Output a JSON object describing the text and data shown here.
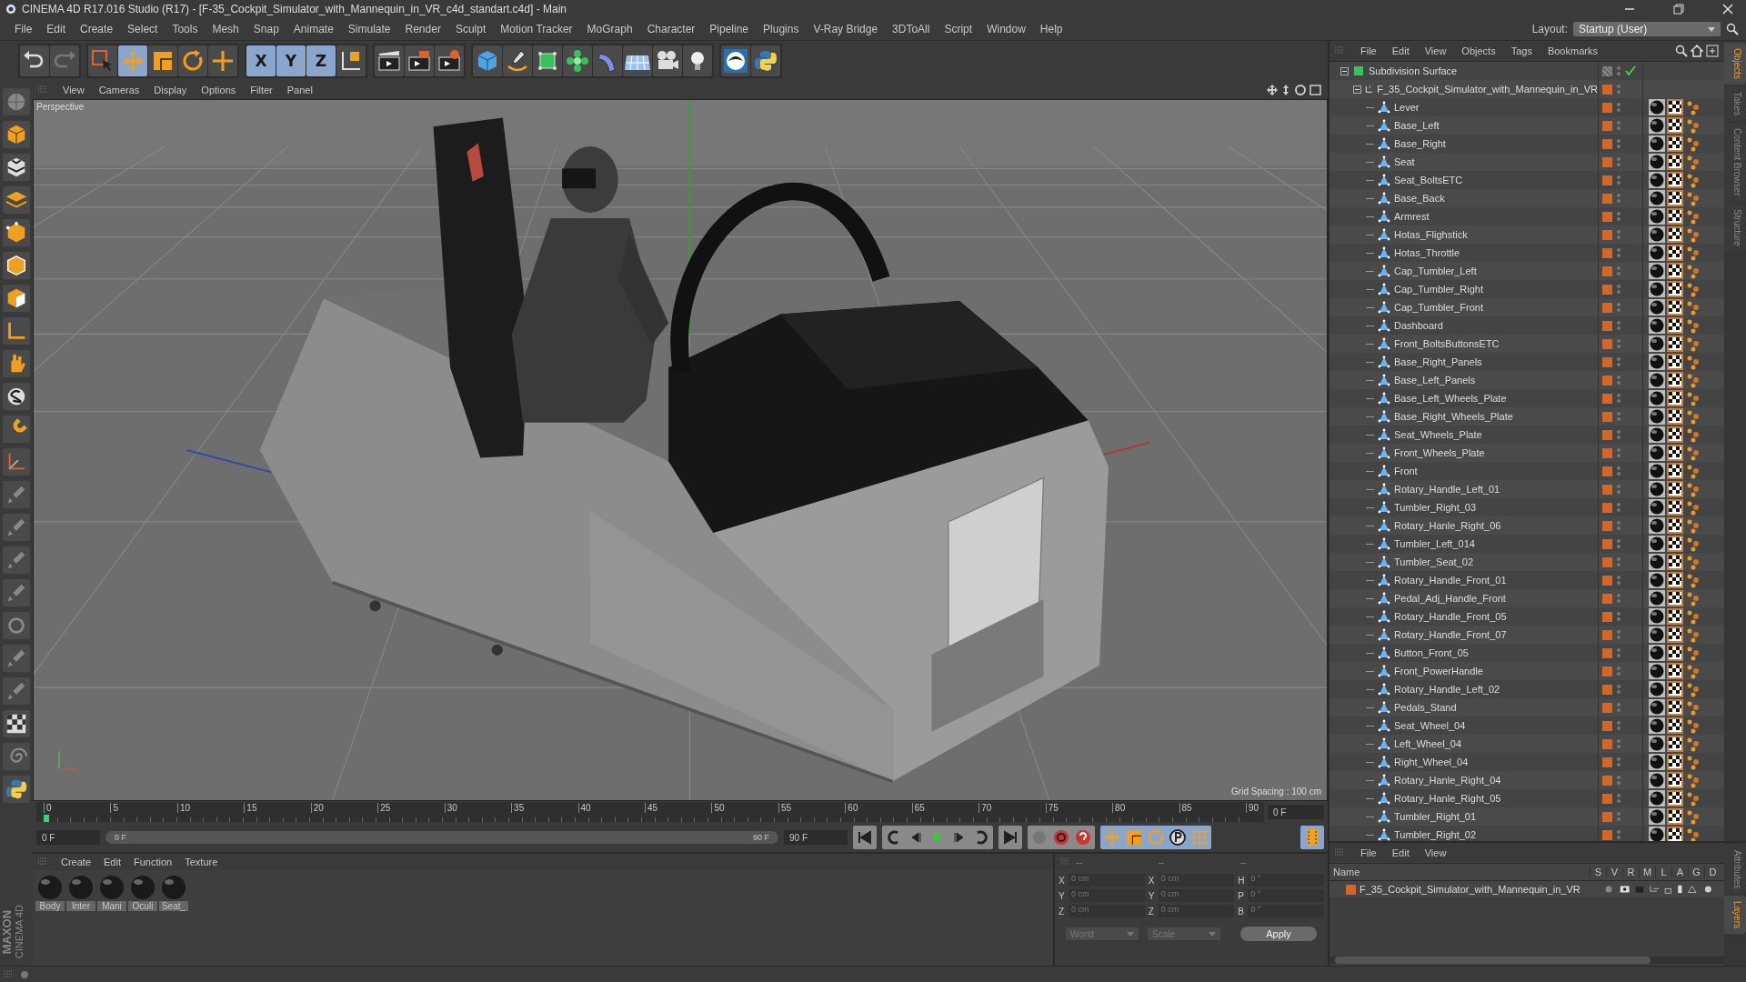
{
  "window": {
    "title": "CINEMA 4D R17.016 Studio (R17) - [F-35_Cockpit_Simulator_with_Mannequin_in_VR_c4d_standart.c4d] - Main"
  },
  "menu": [
    "File",
    "Edit",
    "Create",
    "Select",
    "Tools",
    "Mesh",
    "Snap",
    "Animate",
    "Simulate",
    "Render",
    "Sculpt",
    "Motion Tracker",
    "MoGraph",
    "Character",
    "Pipeline",
    "Plugins",
    "V-Ray Bridge",
    "3DToAll",
    "Script",
    "Window",
    "Help"
  ],
  "layout": {
    "label": "Layout:",
    "value": "Startup (User)"
  },
  "toolbar": [
    [
      {
        "kind": "undo",
        "selected": false
      },
      {
        "kind": "redo",
        "selected": false
      }
    ],
    [
      {
        "kind": "select",
        "selected": false
      },
      {
        "kind": "move",
        "selected": true
      },
      {
        "kind": "scale",
        "selected": false
      },
      {
        "kind": "rotate",
        "selected": false
      },
      {
        "kind": "axis",
        "selected": false
      }
    ],
    [
      {
        "kind": "axis-lock",
        "label": "X",
        "selected": true
      },
      {
        "kind": "axis-lock",
        "label": "Y",
        "selected": true
      },
      {
        "kind": "axis-lock",
        "label": "Z",
        "selected": true
      },
      {
        "kind": "coord",
        "selected": false
      }
    ],
    [
      {
        "kind": "render-view",
        "selected": false
      },
      {
        "kind": "render",
        "selected": false
      },
      {
        "kind": "render-settings",
        "selected": false
      }
    ],
    [
      {
        "kind": "cube",
        "selected": false
      },
      {
        "kind": "pen",
        "selected": false
      },
      {
        "kind": "subdivision",
        "selected": false
      },
      {
        "kind": "cloner",
        "selected": false
      },
      {
        "kind": "deformer",
        "selected": false
      },
      {
        "kind": "floor",
        "selected": false
      },
      {
        "kind": "camera",
        "selected": false
      },
      {
        "kind": "light",
        "selected": false
      }
    ],
    [
      {
        "kind": "sketch",
        "selected": false
      },
      {
        "kind": "python",
        "selected": false
      }
    ]
  ],
  "viewport": {
    "menu": [
      "View",
      "Cameras",
      "Display",
      "Options",
      "Filter",
      "Panel"
    ],
    "camera": "Perspective",
    "grid_spacing": "Grid Spacing : 100 cm"
  },
  "timeline": {
    "ticks": [
      "0",
      "5",
      "10",
      "15",
      "20",
      "25",
      "30",
      "35",
      "40",
      "45",
      "50",
      "55",
      "60",
      "65",
      "70",
      "75",
      "80",
      "85",
      "90"
    ],
    "playhead": {
      "level": 0
    },
    "current_frame": "0 F",
    "start": "0 F",
    "range": {
      "start": "0 F",
      "end": "90 F",
      "level": 1
    },
    "end": "90 F"
  },
  "materials": {
    "menu": [
      "Create",
      "Edit",
      "Function",
      "Texture"
    ],
    "items": [
      "Body",
      "Inter",
      "Mani",
      "Oculi",
      "Seat_"
    ]
  },
  "coordinates": {
    "headers": [
      "--",
      "--",
      "--"
    ],
    "rows": [
      [
        {
          "axis": "X",
          "value": "0 cm"
        },
        {
          "axis": "X",
          "value": "0 cm"
        },
        {
          "axis": "H",
          "value": "0 °"
        }
      ],
      [
        {
          "axis": "Y",
          "value": "0 cm"
        },
        {
          "axis": "Y",
          "value": "0 cm"
        },
        {
          "axis": "P",
          "value": "0 °"
        }
      ],
      [
        {
          "axis": "Z",
          "value": "0 cm"
        },
        {
          "axis": "Z",
          "value": "0 cm"
        },
        {
          "axis": "B",
          "value": "0 °"
        }
      ]
    ],
    "mode": "World",
    "transform": "Scale",
    "apply": "Apply"
  },
  "objects": {
    "menu": [
      "File",
      "Edit",
      "View",
      "Objects",
      "Tags",
      "Bookmarks"
    ],
    "tree": [
      {
        "name": "Subdivision Surface",
        "kind": "generator",
        "expanded": true,
        "enabled": true,
        "children": [
          {
            "name": "F_35_Cockpit_Simulator_with_Mannequin_in_VR",
            "kind": "null",
            "expanded": true,
            "children": [
              {
                "name": "Lever",
                "kind": "polygon"
              },
              {
                "name": "Base_Left",
                "kind": "polygon"
              },
              {
                "name": "Base_Right",
                "kind": "polygon"
              },
              {
                "name": "Seat",
                "kind": "polygon"
              },
              {
                "name": "Seat_BoltsETC",
                "kind": "polygon"
              },
              {
                "name": "Base_Back",
                "kind": "polygon"
              },
              {
                "name": "Armrest",
                "kind": "polygon"
              },
              {
                "name": "Hotas_Flighstick",
                "kind": "polygon"
              },
              {
                "name": "Hotas_Throttle",
                "kind": "polygon"
              },
              {
                "name": "Cap_Tumbler_Left",
                "kind": "polygon"
              },
              {
                "name": "Cap_Tumbler_Right",
                "kind": "polygon"
              },
              {
                "name": "Cap_Tumbler_Front",
                "kind": "polygon"
              },
              {
                "name": "Dashboard",
                "kind": "polygon"
              },
              {
                "name": "Front_BoltsButtonsETC",
                "kind": "polygon"
              },
              {
                "name": "Base_Right_Panels",
                "kind": "polygon"
              },
              {
                "name": "Base_Left_Panels",
                "kind": "polygon"
              },
              {
                "name": "Base_Left_Wheels_Plate",
                "kind": "polygon"
              },
              {
                "name": "Base_Right_Wheels_Plate",
                "kind": "polygon"
              },
              {
                "name": "Seat_Wheels_Plate",
                "kind": "polygon"
              },
              {
                "name": "Front_Wheels_Plate",
                "kind": "polygon"
              },
              {
                "name": "Front",
                "kind": "polygon"
              },
              {
                "name": "Rotary_Handle_Left_01",
                "kind": "polygon"
              },
              {
                "name": "Tumbler_Right_03",
                "kind": "polygon"
              },
              {
                "name": "Rotary_Hanle_Right_06",
                "kind": "polygon"
              },
              {
                "name": "Tumbler_Left_014",
                "kind": "polygon"
              },
              {
                "name": "Tumbler_Seat_02",
                "kind": "polygon"
              },
              {
                "name": "Rotary_Handle_Front_01",
                "kind": "polygon"
              },
              {
                "name": "Pedal_Adj_Handle_Front",
                "kind": "polygon"
              },
              {
                "name": "Rotary_Handle_Front_05",
                "kind": "polygon"
              },
              {
                "name": "Rotary_Handle_Front_07",
                "kind": "polygon"
              },
              {
                "name": "Button_Front_05",
                "kind": "polygon"
              },
              {
                "name": "Front_PowerHandle",
                "kind": "polygon"
              },
              {
                "name": "Rotary_Handle_Left_02",
                "kind": "polygon"
              },
              {
                "name": "Pedals_Stand",
                "kind": "polygon"
              },
              {
                "name": "Seat_Wheel_04",
                "kind": "polygon"
              },
              {
                "name": "Left_Wheel_04",
                "kind": "polygon"
              },
              {
                "name": "Right_Wheel_04",
                "kind": "polygon"
              },
              {
                "name": "Rotary_Hanle_Right_04",
                "kind": "polygon"
              },
              {
                "name": "Rotary_Hanle_Right_05",
                "kind": "polygon"
              },
              {
                "name": "Tumbler_Right_01",
                "kind": "polygon"
              },
              {
                "name": "Tumbler_Right_02",
                "kind": "polygon"
              }
            ]
          }
        ]
      }
    ]
  },
  "side_tabs": [
    {
      "label": "Objects",
      "selected": true
    },
    {
      "label": "Takes",
      "selected": false
    },
    {
      "label": "Content Browser",
      "selected": false
    },
    {
      "label": "Structure",
      "selected": false
    }
  ],
  "layers": {
    "menu": [
      "File",
      "Edit",
      "View"
    ],
    "columns": [
      "Name",
      "S",
      "V",
      "R",
      "M",
      "L",
      "A",
      "G",
      "D"
    ],
    "rows": [
      {
        "name": "F_35_Cockpit_Simulator_with_Mannequin_in_VR",
        "color": "#d2672a"
      }
    ]
  },
  "layer_tabs": [
    {
      "label": "Attributes",
      "selected": false
    },
    {
      "label": "Layers",
      "selected": true
    }
  ],
  "logo": {
    "brand": "MAXON",
    "product": "CINEMA 4D"
  }
}
